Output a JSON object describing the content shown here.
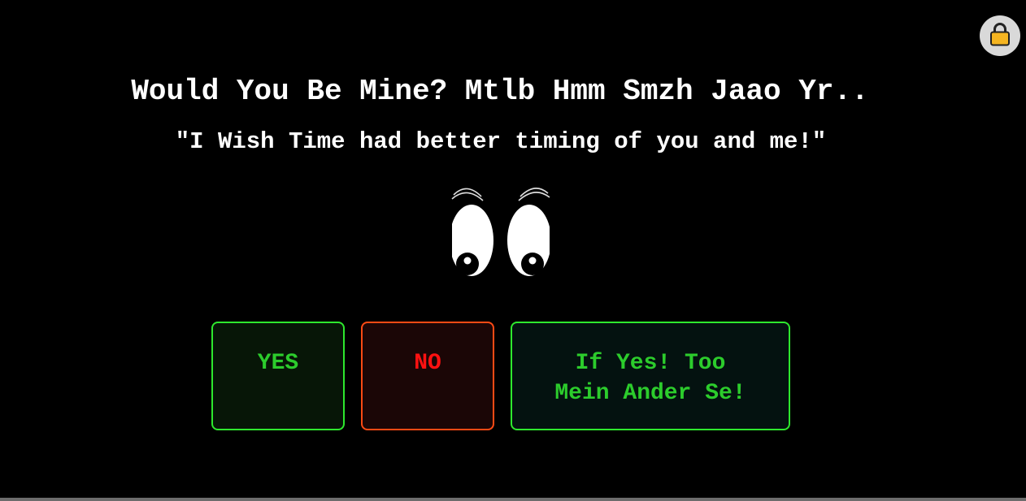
{
  "header": {
    "title": "Would You Be Mine? Mtlb Hmm Smzh Jaao Yr..",
    "quote": "\"I Wish Time had better timing of you and me!\""
  },
  "lock": {
    "icon": "lock-icon"
  },
  "eyes": {
    "icon": "cartoon-eyes-icon"
  },
  "buttons": {
    "yes": "YES",
    "no": "NO",
    "alt_line1": "If Yes! Too",
    "alt_line2": "Mein Ander Se!"
  },
  "colors": {
    "background": "#000000",
    "yes_green": "#2ccc2c",
    "yes_border": "#2ee82e",
    "no_red": "#ff1111",
    "no_border": "#ff4a14",
    "lock_gold": "#f5b521"
  }
}
